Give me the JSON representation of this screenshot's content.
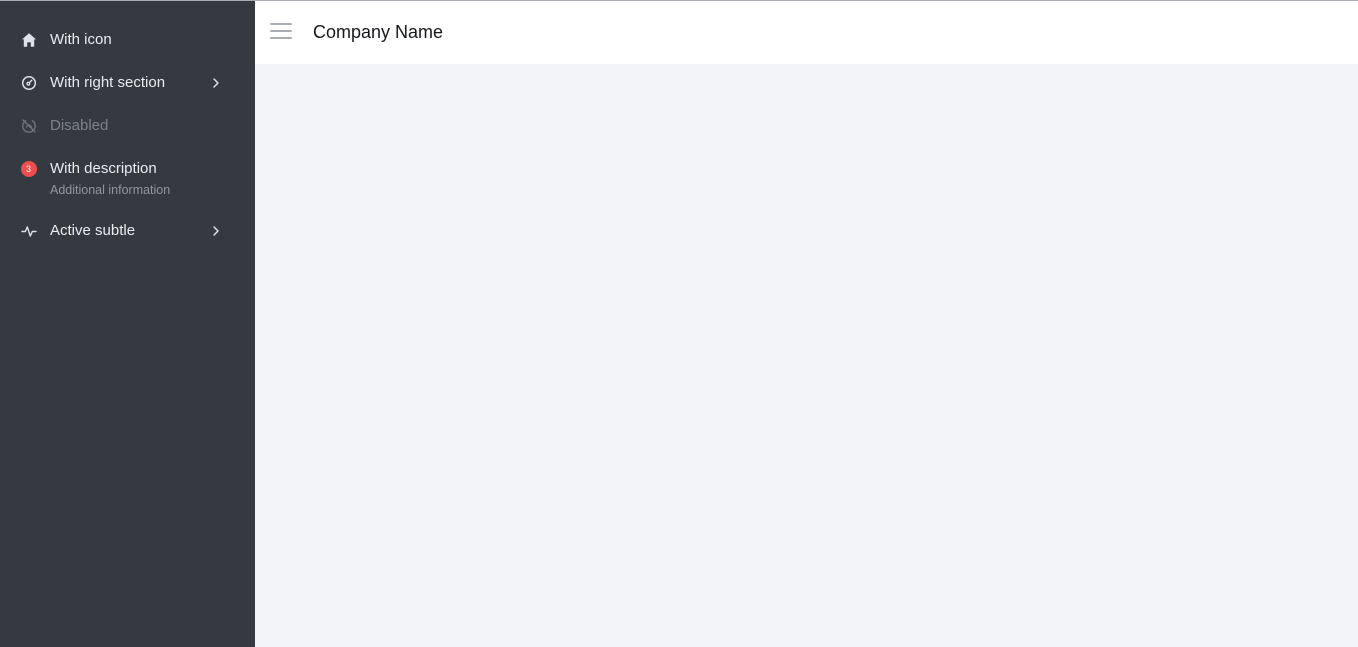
{
  "header": {
    "title": "Company Name"
  },
  "sidebar": {
    "items": [
      {
        "label": "With icon",
        "icon": "home-icon"
      },
      {
        "label": "With right section",
        "icon": "gauge-icon",
        "right": "chevron-right-icon"
      },
      {
        "label": "Disabled",
        "icon": "fingerprint-off-icon",
        "disabled": true
      },
      {
        "label": "With description",
        "description": "Additional information",
        "badge": "3"
      },
      {
        "label": "Active subtle",
        "icon": "activity-icon",
        "right": "chevron-right-icon"
      }
    ]
  },
  "colors": {
    "sidebar_bg": "#343a40",
    "main_bg": "#f3f4f8",
    "badge": "#f04d4d"
  }
}
